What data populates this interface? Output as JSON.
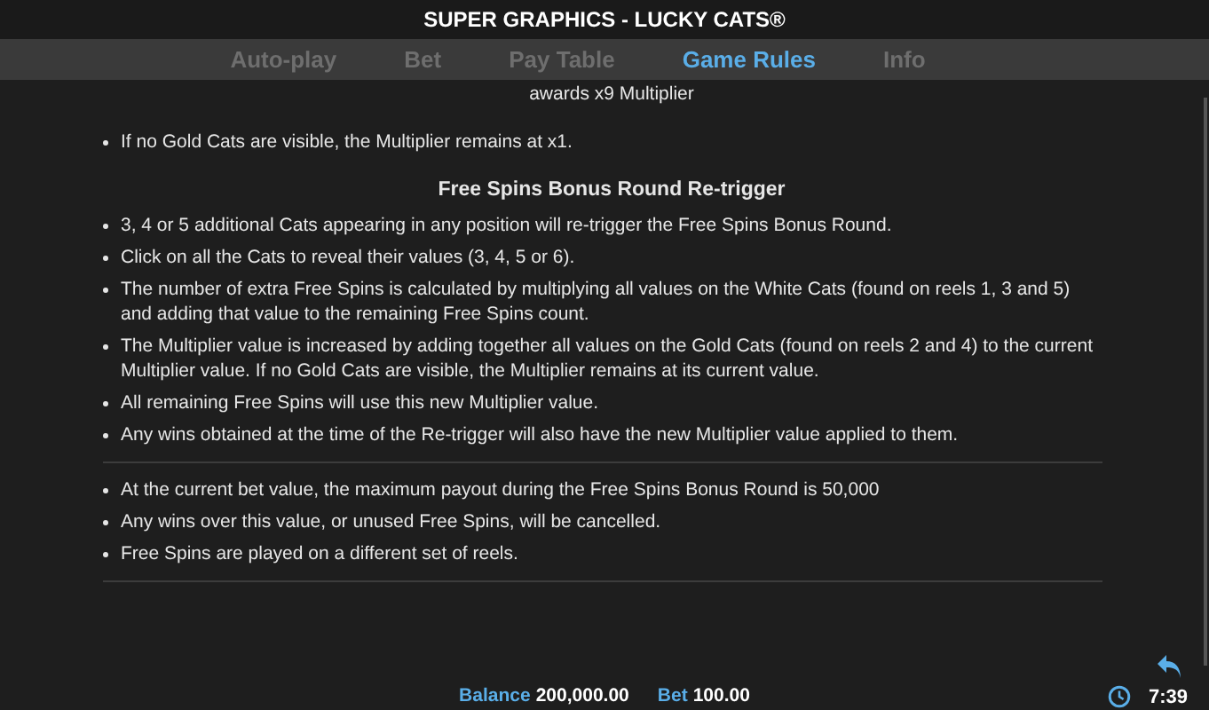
{
  "title": "SUPER GRAPHICS - LUCKY CATS®",
  "tabs": [
    {
      "label": "Auto-play",
      "selected": false
    },
    {
      "label": "Bet",
      "selected": false
    },
    {
      "label": "Pay Table",
      "selected": false
    },
    {
      "label": "Game Rules",
      "selected": true
    },
    {
      "label": "Info",
      "selected": false
    }
  ],
  "blocks": [
    {
      "kind": "caption",
      "text": "awards x9 Multiplier"
    },
    {
      "kind": "bullet",
      "text": "If no Gold Cats are visible, the Multiplier remains at x1."
    },
    {
      "kind": "heading",
      "text": "Free Spins Bonus Round Re-trigger"
    },
    {
      "kind": "bullet",
      "text": "3, 4 or 5 additional Cats appearing in any position will re-trigger the Free Spins Bonus Round."
    },
    {
      "kind": "bullet",
      "text": "Click on all the Cats to reveal their values (3, 4, 5 or 6)."
    },
    {
      "kind": "bullet",
      "text": "The number of extra Free Spins is calculated by multiplying all values on the White Cats (found on reels 1, 3 and 5) and adding that value to the remaining Free Spins count."
    },
    {
      "kind": "bullet",
      "text": "The Multiplier value is increased by adding together all values on the Gold Cats (found on reels 2 and 4) to the current Multiplier value. If no Gold Cats are visible, the Multiplier remains at its current value."
    },
    {
      "kind": "bullet",
      "text": "All remaining Free Spins will use this new Multiplier value."
    },
    {
      "kind": "bullet",
      "text": "Any wins obtained at the time of the Re-trigger will also have the new Multiplier value applied to them."
    },
    {
      "kind": "divider"
    },
    {
      "kind": "bullet",
      "text": "At the current bet value, the maximum payout during the Free Spins Bonus Round is 50,000"
    },
    {
      "kind": "bullet",
      "text": "Any wins over this value, or unused Free Spins, will be cancelled."
    },
    {
      "kind": "bullet",
      "text": "Free Spins are played on a different set of reels."
    },
    {
      "kind": "divider"
    }
  ],
  "footer": {
    "balance_label": "Balance",
    "balance": "200,000.00",
    "bet_label": "Bet",
    "bet": "100.00",
    "time": "7:39"
  }
}
